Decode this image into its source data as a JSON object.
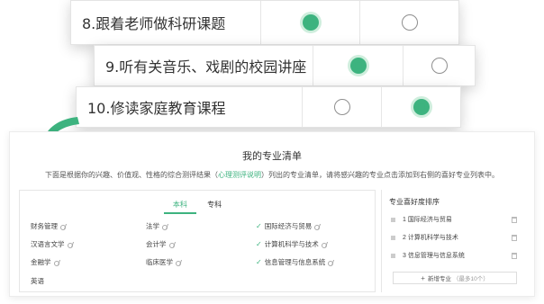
{
  "survey": {
    "q8": {
      "text": "8.跟着老师做科研课题",
      "selected": 0
    },
    "q9": {
      "text": "9.听有关音乐、戏剧的校园讲座",
      "selected": 0
    },
    "q10": {
      "text": "10.修读家庭教育课程",
      "selected": 1
    }
  },
  "panel": {
    "title": "我的专业清单",
    "desc_prefix": "下面是根据你的兴趣、价值观、性格的综合测评结果（",
    "desc_link": "心理测评说明",
    "desc_suffix": "）列出的专业清单，请将感兴趣的专业点击添加到右侧的喜好专业列表中。",
    "tabs": [
      "本科",
      "专科"
    ],
    "majors": [
      {
        "label": "财务管理",
        "checked": false
      },
      {
        "label": "法学",
        "checked": false
      },
      {
        "label": "国际经济与贸易",
        "checked": true
      },
      {
        "label": "汉语言文学",
        "checked": false
      },
      {
        "label": "会计学",
        "checked": false
      },
      {
        "label": "计算机科学与技术",
        "checked": true
      },
      {
        "label": "金融学",
        "checked": false
      },
      {
        "label": "临床医学",
        "checked": false
      },
      {
        "label": "信息管理与信息系统",
        "checked": true
      },
      {
        "label": "英语",
        "checked": false
      }
    ],
    "ranking_title": "专业喜好度排序",
    "ranking": [
      "1 国际经济与贸易",
      "2 计算机科学与技术",
      "3 信息管理与信息系统"
    ],
    "add_label": "新增专业",
    "add_note": "（最多10个）"
  },
  "colors": {
    "accent": "#3db37f"
  }
}
